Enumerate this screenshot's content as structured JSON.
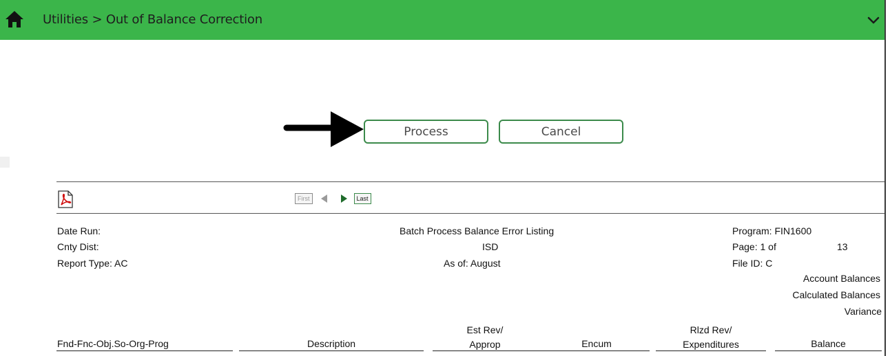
{
  "header": {
    "breadcrumb": "Utilities > Out of Balance Correction",
    "home_icon": "home-icon",
    "expand_icon": "chevron-down-icon",
    "bg_color": "#3bb54a"
  },
  "actions": {
    "process_label": "Process",
    "cancel_label": "Cancel"
  },
  "toolbar": {
    "pdf_icon": "pdf-icon",
    "first_label": "First",
    "last_label": "Last"
  },
  "report": {
    "date_run": "Date Run:",
    "cnty_dist": "Cnty Dist:",
    "report_type": "Report Type: AC",
    "title": "Batch Process Balance Error Listing",
    "district": "ISD",
    "as_of": "As of: August",
    "program": "Program: FIN1600",
    "page_label": "Page: 1 of",
    "page_total": "13",
    "file_id": "File ID: C",
    "account_balances": "Account Balances",
    "calculated_balances": "Calculated Balances",
    "variance": "Variance"
  },
  "columns": {
    "account": "Fnd-Fnc-Obj.So-Org-Prog",
    "description": "Description",
    "est_rev_line1": "Est Rev/",
    "est_rev_line2": "Approp",
    "encum": "Encum",
    "rlzd_line1": "Rlzd Rev/",
    "rlzd_line2": "Expenditures",
    "balance": "Balance"
  }
}
